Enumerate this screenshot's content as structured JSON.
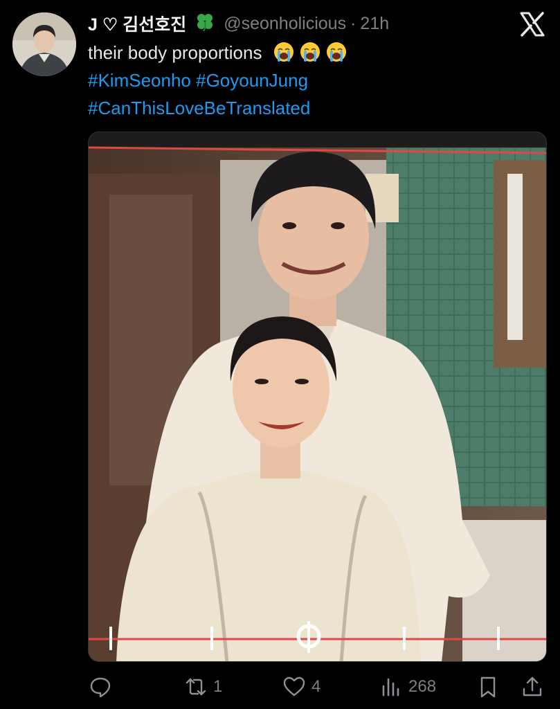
{
  "tweet": {
    "display_name": "J ♡ 김선호진",
    "name_emoji": "four-leaf-clover",
    "handle": "@seonholicious",
    "separator": "·",
    "time": "21h",
    "text": "their body proportions",
    "text_emojis": [
      "loudly-crying-face",
      "loudly-crying-face",
      "loudly-crying-face"
    ],
    "hashtags_line1": [
      "#KimSeonho",
      "#GoyounJung"
    ],
    "hashtag_line2": "#CanThisLoveBeTranslated"
  },
  "media": {
    "description_icon": "photo",
    "scrubber_progress": 0.48
  },
  "actions": {
    "reply": {
      "icon": "reply-icon",
      "count": ""
    },
    "retweet": {
      "icon": "retweet-icon",
      "count": "1"
    },
    "like": {
      "icon": "heart-icon",
      "count": "4"
    },
    "views": {
      "icon": "views-icon",
      "count": "268"
    },
    "bookmark": {
      "icon": "bookmark-icon"
    },
    "share": {
      "icon": "share-icon"
    }
  },
  "colors": {
    "background": "#000000",
    "hashtag": "#1d9bf0",
    "secondary_text": "#7b8186",
    "primary_text": "#e7e9ea"
  }
}
